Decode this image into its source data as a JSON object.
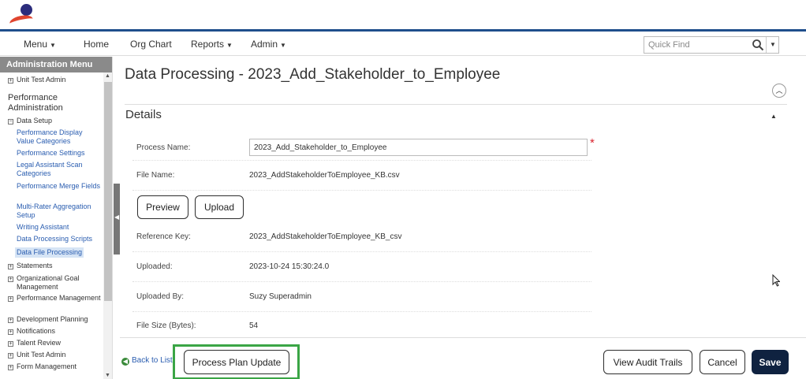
{
  "nav": {
    "menu": "Menu",
    "home": "Home",
    "org_chart": "Org Chart",
    "reports": "Reports",
    "admin": "Admin",
    "quick_find_placeholder": "Quick Find"
  },
  "sidebar": {
    "header": "Administration Menu",
    "top_item": "Unit Test Admin",
    "section": "Performance Administration",
    "data_setup": "Data Setup",
    "links": [
      "Performance Display Value Categories",
      "Performance Settings",
      "Legal Assistant Scan Categories",
      "Performance Merge Fields",
      "Multi-Rater Aggregation Setup",
      "Writing Assistant",
      "Data Processing Scripts",
      "Data File Processing"
    ],
    "groups": [
      "Statements",
      "Organizational Goal Management",
      "Performance Management",
      "Development Planning",
      "Notifications",
      "Talent Review",
      "Unit Test Admin",
      "Form Management"
    ]
  },
  "page": {
    "title": "Data Processing - 2023_Add_Stakeholder_to_Employee",
    "section_title": "Details"
  },
  "fields": {
    "process_name_label": "Process Name:",
    "process_name_value": "2023_Add_Stakeholder_to_Employee",
    "file_name_label": "File Name:",
    "file_name_value": "2023_AddStakeholderToEmployee_KB.csv",
    "reference_key_label": "Reference Key:",
    "reference_key_value": "2023_AddStakeholderToEmployee_KB_csv",
    "uploaded_label": "Uploaded:",
    "uploaded_value": "2023-10-24 15:30:24.0",
    "uploaded_by_label": "Uploaded By:",
    "uploaded_by_value": "Suzy Superadmin",
    "file_size_label": "File Size (Bytes):",
    "file_size_value": "54"
  },
  "buttons": {
    "preview": "Preview",
    "upload": "Upload",
    "back_to_list": "Back to List",
    "process_plan_update": "Process Plan Update",
    "view_audit_trails": "View Audit Trails",
    "cancel": "Cancel",
    "save": "Save"
  },
  "colors": {
    "nav_border": "#1f4e8c",
    "highlight": "#3aa545",
    "save_bg": "#0f2240",
    "required": "#d9232e"
  }
}
